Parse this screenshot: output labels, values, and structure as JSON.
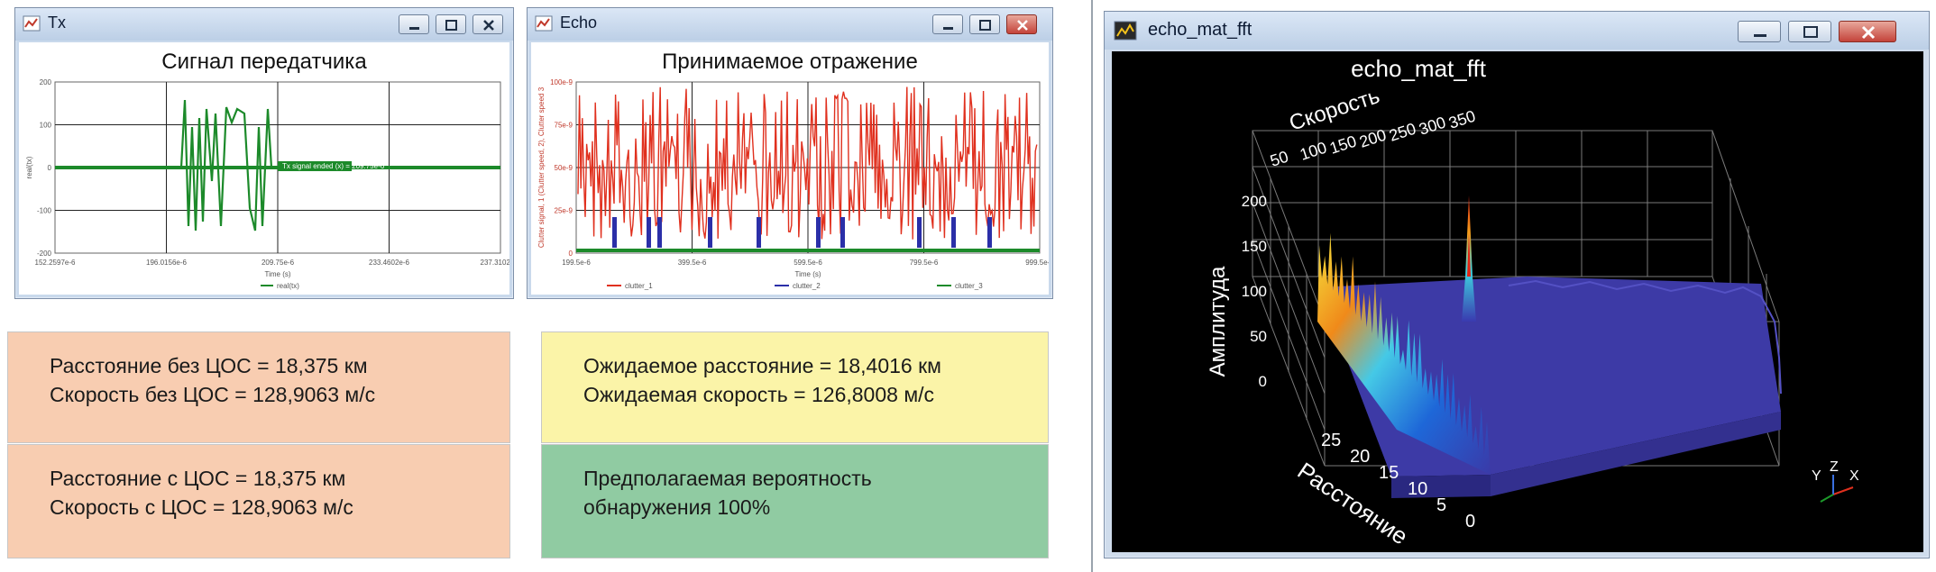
{
  "tx_window": {
    "title": "Tx",
    "plot_title": "Сигнал передатчика",
    "x_ticks": [
      "152.2597e-6",
      "196.0156e-6",
      "209.75e-6",
      "233.4602e-6",
      "237.3102e-6"
    ],
    "y_ticks": [
      "200",
      "100",
      "0",
      "-100",
      "-200"
    ],
    "xlabel": "Time (s)",
    "ylabel": "real(tx)",
    "legend": "real(tx)",
    "tooltip": "Tx signal ended (x) = 209.75e-6"
  },
  "echo_window": {
    "title": "Echo",
    "plot_title": "Принимаемое отражение",
    "x_ticks": [
      "199.5e-6",
      "399.5e-6",
      "599.5e-6",
      "799.5e-6",
      "999.5e-6"
    ],
    "y_ticks": [
      "100e-9",
      "75e-9",
      "50e-9",
      "25e-9",
      "0"
    ],
    "xlabel": "Time (s)",
    "ylabel": "Clutter signal, 1 (Clutter speed, 2), Clutter speed 3",
    "legend": [
      "clutter_1",
      "clutter_2",
      "clutter_3"
    ]
  },
  "fft_window": {
    "title": "echo_mat_fft",
    "plot_title": "echo_mat_fft",
    "velocity_label": "Скорость",
    "velocity_ticks": [
      "50",
      "100",
      "150",
      "200",
      "250",
      "300",
      "350"
    ],
    "amplitude_label": "Амплитуда",
    "amplitude_ticks": [
      "200",
      "150",
      "100",
      "50",
      "0"
    ],
    "range_label": "Расстояние",
    "range_ticks": [
      "25",
      "20",
      "15",
      "10",
      "5",
      "0"
    ],
    "axes_gizmo": {
      "y": "Y",
      "z": "Z",
      "x": "X"
    }
  },
  "panels": {
    "no_cos": {
      "line1": "Расстояние без ЦОС = 18,375 км",
      "line2": "Скорость без ЦОС = 128,9063 м/с",
      "color": "#f8cdb1"
    },
    "with_cos": {
      "line1": "Расстояние с ЦОС = 18,375 км",
      "line2": "Скорость с ЦОС = 128,9063 м/с",
      "color": "#f8cdb1"
    },
    "expected": {
      "line1": "Ожидаемое расстояние = 18,4016 км",
      "line2": "Ожидаемая скорость = 126,8008 м/с",
      "color": "#fbf4a8"
    },
    "probability": {
      "line1": "Предполагаемая вероятность",
      "line2": "обнаружения 100%",
      "color": "#90cba2"
    }
  }
}
